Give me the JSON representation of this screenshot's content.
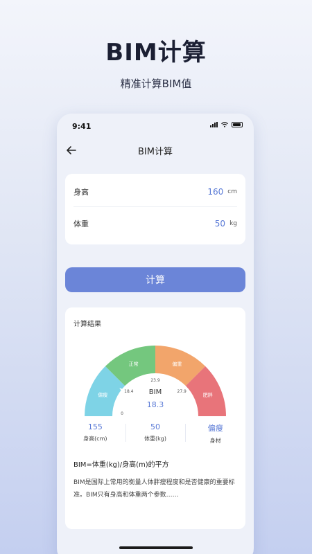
{
  "hero": {
    "title": "BIM计算",
    "subtitle": "精准计算BIM值"
  },
  "status_bar": {
    "time": "9:41"
  },
  "nav": {
    "title": "BIM计算",
    "back_icon": "arrow-left-icon"
  },
  "form": {
    "height_label": "身高",
    "height_value": "160",
    "height_unit": "cm",
    "weight_label": "体重",
    "weight_value": "50",
    "weight_unit": "kg"
  },
  "calc_button": "计算",
  "result": {
    "title": "计算结果",
    "gauge": {
      "segments": [
        {
          "label": "偏瘦",
          "color": "#7ed3e6"
        },
        {
          "label": "正常",
          "color": "#74c77e"
        },
        {
          "label": "偏重",
          "color": "#f2a56b"
        },
        {
          "label": "肥胖",
          "color": "#e8747a"
        }
      ],
      "thresholds": [
        "0",
        "18.4",
        "23.9",
        "27.9"
      ],
      "center_label": "BIM",
      "center_value": "18.3"
    },
    "stats": [
      {
        "value": "155",
        "label": "身高(cm)"
      },
      {
        "value": "50",
        "label": "体重(kg)"
      },
      {
        "value": "偏瘦",
        "label": "身材"
      }
    ],
    "formula": "BIM=体重(kg)/身高(m)的平方",
    "description": "BIM是国际上常用的衡量人体胖瘦程度和是否健康的重要标准。BIM只有身高和体重两个参数……"
  }
}
